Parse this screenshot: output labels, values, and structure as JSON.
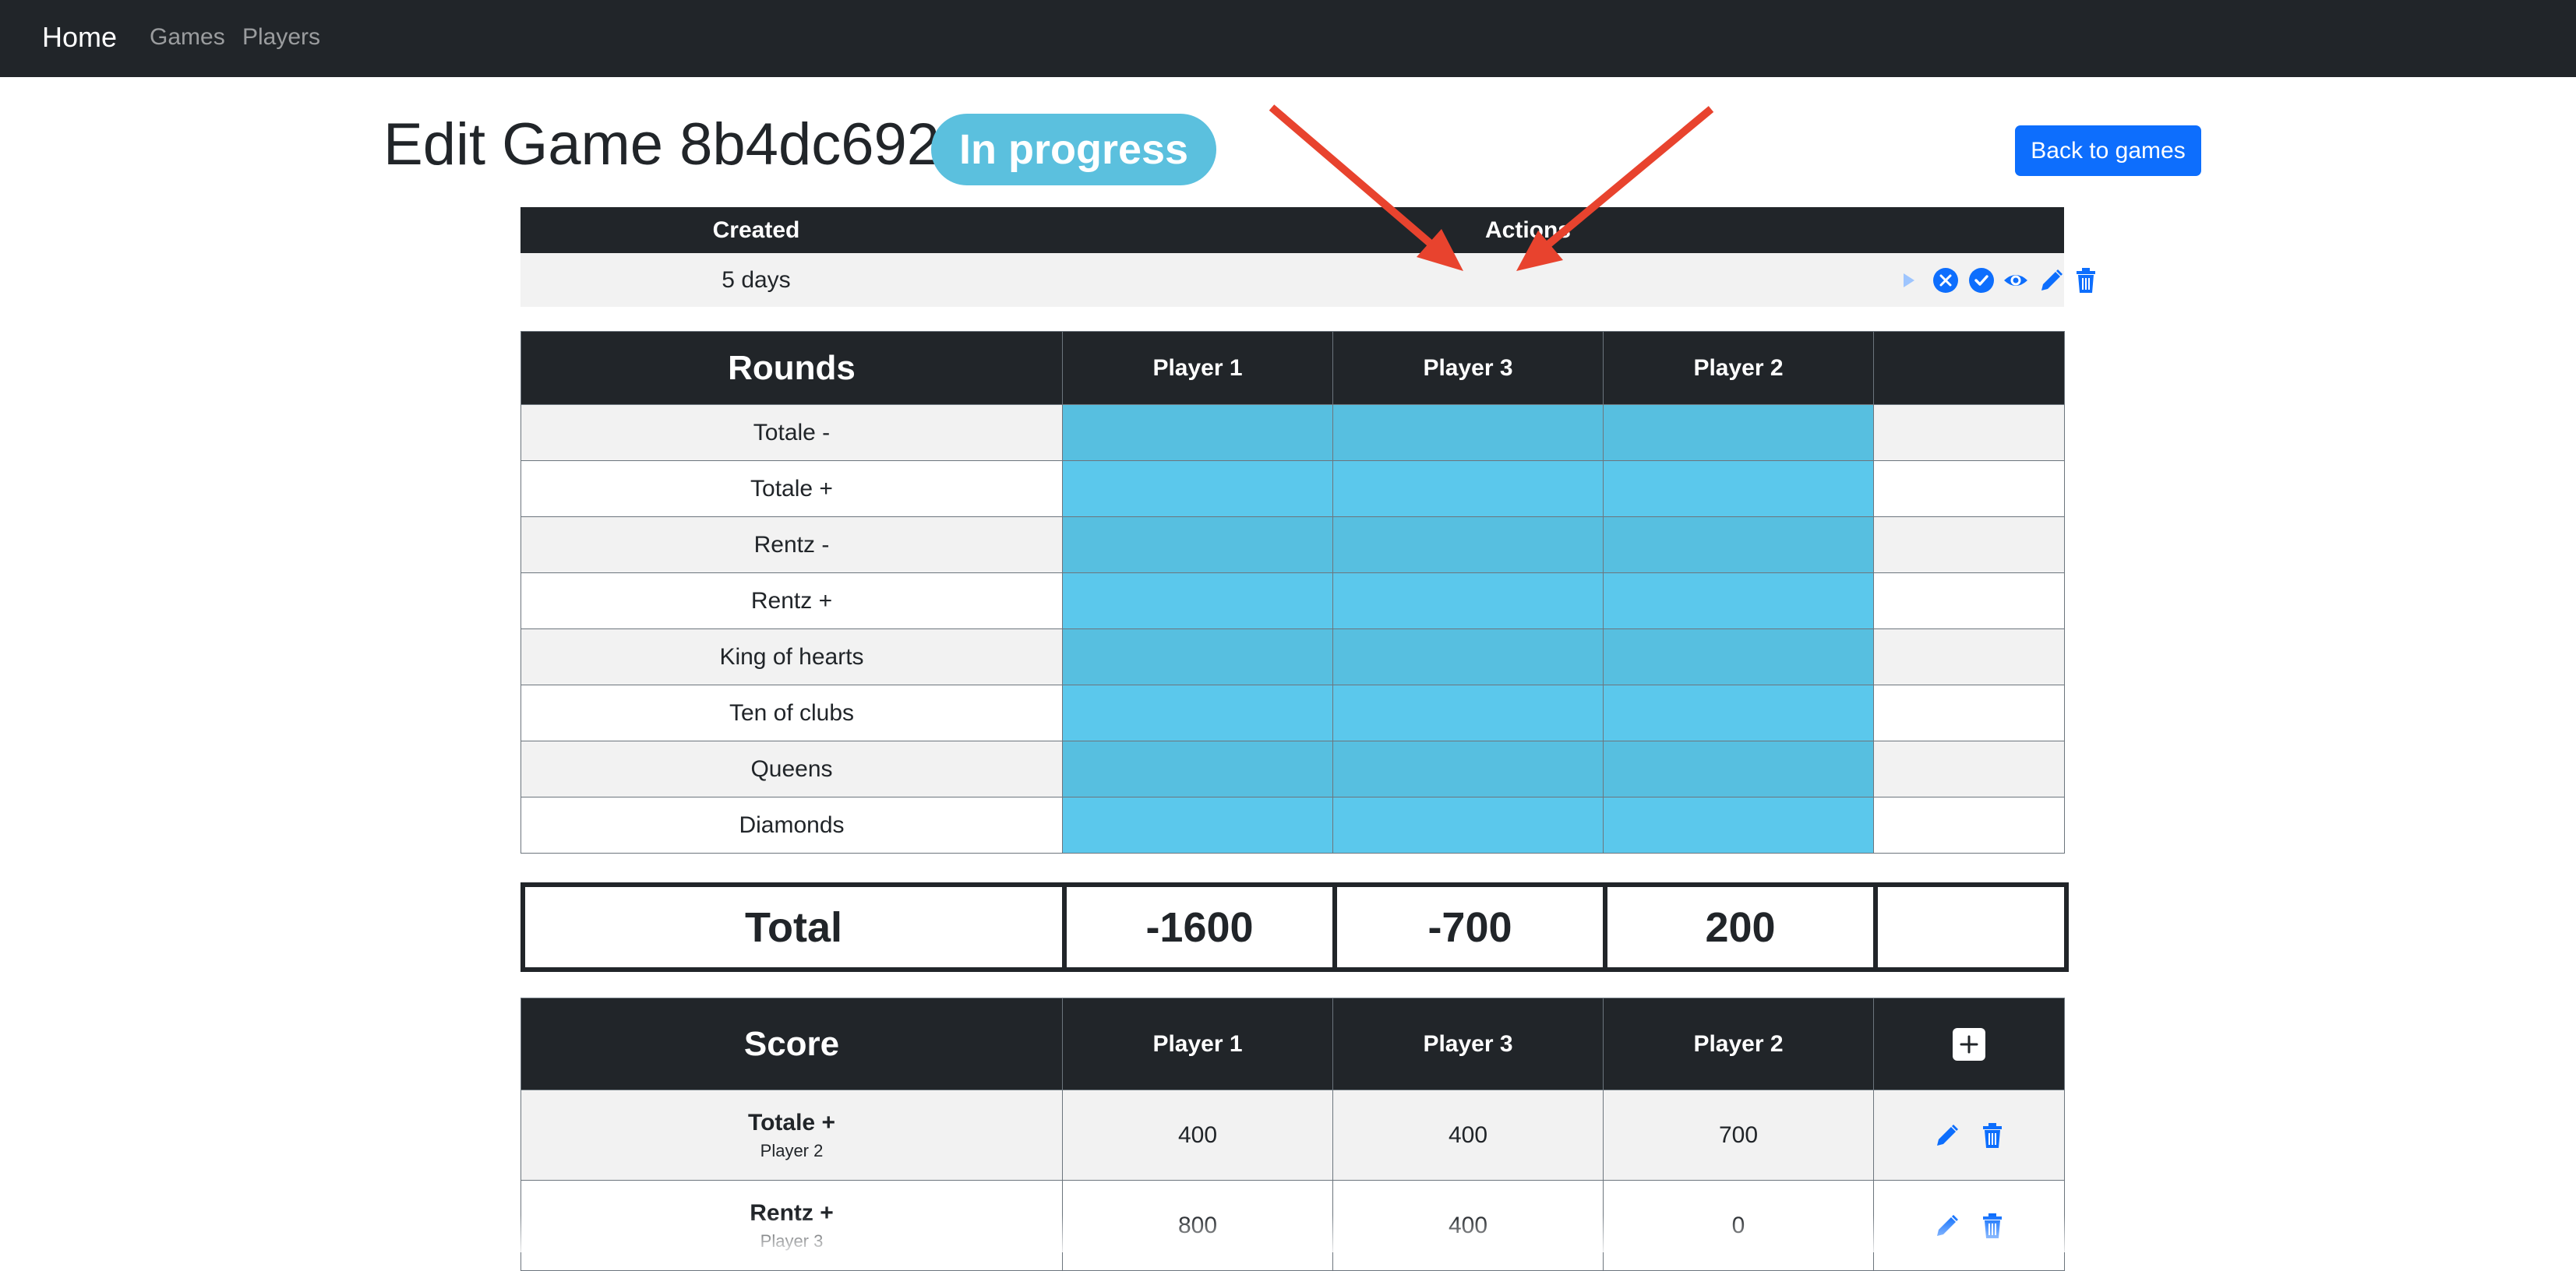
{
  "navbar": {
    "brand": "Home",
    "links": [
      "Games",
      "Players"
    ]
  },
  "header": {
    "title": "Edit Game 8b4dc692",
    "status": "In progress",
    "back_label": "Back to games"
  },
  "info": {
    "headers": [
      "Created",
      "Actions"
    ],
    "created": "5 days",
    "action_icons": [
      "play-icon",
      "cancel-icon",
      "complete-icon",
      "view-icon",
      "edit-icon",
      "delete-icon"
    ]
  },
  "players": [
    "Player 1",
    "Player 3",
    "Player 2"
  ],
  "rounds": {
    "title": "Rounds",
    "items": [
      "Totale -",
      "Totale +",
      "Rentz -",
      "Rentz +",
      "King of hearts",
      "Ten of clubs",
      "Queens",
      "Diamonds"
    ]
  },
  "total": {
    "label": "Total",
    "values": [
      "-1600",
      "-700",
      "200"
    ]
  },
  "score": {
    "title": "Score",
    "rows": [
      {
        "round": "Totale +",
        "player": "Player 2",
        "values": [
          "400",
          "400",
          "700"
        ]
      },
      {
        "round": "Rentz +",
        "player": "Player 3",
        "values": [
          "800",
          "400",
          "0"
        ]
      }
    ]
  },
  "colors": {
    "navbar": "#212529",
    "accent": "#0d6efd",
    "info": "#5bc0de",
    "annotation": "#e8432e"
  }
}
